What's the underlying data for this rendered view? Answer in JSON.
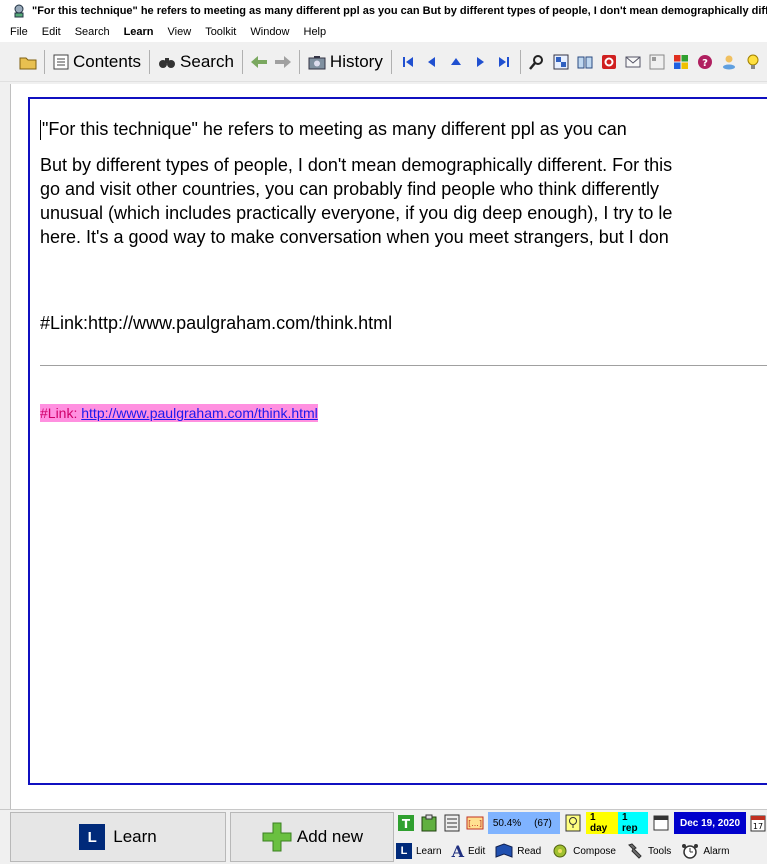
{
  "window": {
    "title": "\"For this technique\" he refers to meeting as many different ppl as you can But by different types of people, I don't mean demographically different."
  },
  "menu": [
    {
      "label": "File"
    },
    {
      "label": "Edit"
    },
    {
      "label": "Search"
    },
    {
      "label": "Learn",
      "bold": true
    },
    {
      "label": "View"
    },
    {
      "label": "Toolkit"
    },
    {
      "label": "Window"
    },
    {
      "label": "Help"
    }
  ],
  "toolbar": {
    "contents_label": "Contents",
    "search_label": "Search",
    "history_label": "History"
  },
  "editor": {
    "line1": "\"For this technique\" he refers to meeting as many different ppl as you can",
    "para2": [
      "But by different types of people, I don't mean demographically different. For this",
      "go and visit other countries, you can probably find people who think differently",
      "unusual (which includes practically everyone, if you dig deep enough), I try to le",
      "here. It's a good way to make conversation when you meet strangers, but I don"
    ],
    "link_text": "#Link:http://www.paulgraham.com/think.html",
    "link_label": "#Link: ",
    "link_url": "http://www.paulgraham.com/think.html"
  },
  "bottom": {
    "learn_label": "Learn",
    "add_new_label": "Add new",
    "L_letter": "L",
    "status": {
      "percent": "50.4%",
      "count": "(67)",
      "interval": "1 day",
      "reps": "1 rep",
      "date": "Dec 19, 2020",
      "calendar_day": "17"
    },
    "tabs": [
      {
        "label": "Learn"
      },
      {
        "label": "Edit"
      },
      {
        "label": "Read"
      },
      {
        "label": "Compose"
      },
      {
        "label": "Tools"
      },
      {
        "label": "Alarm"
      }
    ],
    "edit_glyph": "A"
  },
  "colors": {
    "editor_border": "#1010c0",
    "link_highlight": "#ff90e0",
    "link_label": "#d0006a",
    "link_url": "#1a1aee",
    "chip_blue": "#7fb3ff",
    "chip_yellow": "#ffff00",
    "chip_cyan": "#00ffff",
    "chip_date": "#0000cc"
  }
}
